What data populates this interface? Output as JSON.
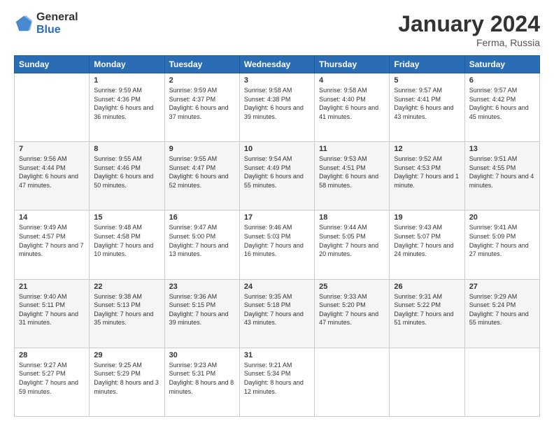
{
  "header": {
    "logo_general": "General",
    "logo_blue": "Blue",
    "month_title": "January 2024",
    "location": "Ferma, Russia"
  },
  "days_of_week": [
    "Sunday",
    "Monday",
    "Tuesday",
    "Wednesday",
    "Thursday",
    "Friday",
    "Saturday"
  ],
  "weeks": [
    [
      {
        "day": "",
        "sunrise": "",
        "sunset": "",
        "daylight": ""
      },
      {
        "day": "1",
        "sunrise": "Sunrise: 9:59 AM",
        "sunset": "Sunset: 4:36 PM",
        "daylight": "Daylight: 6 hours and 36 minutes."
      },
      {
        "day": "2",
        "sunrise": "Sunrise: 9:59 AM",
        "sunset": "Sunset: 4:37 PM",
        "daylight": "Daylight: 6 hours and 37 minutes."
      },
      {
        "day": "3",
        "sunrise": "Sunrise: 9:58 AM",
        "sunset": "Sunset: 4:38 PM",
        "daylight": "Daylight: 6 hours and 39 minutes."
      },
      {
        "day": "4",
        "sunrise": "Sunrise: 9:58 AM",
        "sunset": "Sunset: 4:40 PM",
        "daylight": "Daylight: 6 hours and 41 minutes."
      },
      {
        "day": "5",
        "sunrise": "Sunrise: 9:57 AM",
        "sunset": "Sunset: 4:41 PM",
        "daylight": "Daylight: 6 hours and 43 minutes."
      },
      {
        "day": "6",
        "sunrise": "Sunrise: 9:57 AM",
        "sunset": "Sunset: 4:42 PM",
        "daylight": "Daylight: 6 hours and 45 minutes."
      }
    ],
    [
      {
        "day": "7",
        "sunrise": "Sunrise: 9:56 AM",
        "sunset": "Sunset: 4:44 PM",
        "daylight": "Daylight: 6 hours and 47 minutes."
      },
      {
        "day": "8",
        "sunrise": "Sunrise: 9:55 AM",
        "sunset": "Sunset: 4:46 PM",
        "daylight": "Daylight: 6 hours and 50 minutes."
      },
      {
        "day": "9",
        "sunrise": "Sunrise: 9:55 AM",
        "sunset": "Sunset: 4:47 PM",
        "daylight": "Daylight: 6 hours and 52 minutes."
      },
      {
        "day": "10",
        "sunrise": "Sunrise: 9:54 AM",
        "sunset": "Sunset: 4:49 PM",
        "daylight": "Daylight: 6 hours and 55 minutes."
      },
      {
        "day": "11",
        "sunrise": "Sunrise: 9:53 AM",
        "sunset": "Sunset: 4:51 PM",
        "daylight": "Daylight: 6 hours and 58 minutes."
      },
      {
        "day": "12",
        "sunrise": "Sunrise: 9:52 AM",
        "sunset": "Sunset: 4:53 PM",
        "daylight": "Daylight: 7 hours and 1 minute."
      },
      {
        "day": "13",
        "sunrise": "Sunrise: 9:51 AM",
        "sunset": "Sunset: 4:55 PM",
        "daylight": "Daylight: 7 hours and 4 minutes."
      }
    ],
    [
      {
        "day": "14",
        "sunrise": "Sunrise: 9:49 AM",
        "sunset": "Sunset: 4:57 PM",
        "daylight": "Daylight: 7 hours and 7 minutes."
      },
      {
        "day": "15",
        "sunrise": "Sunrise: 9:48 AM",
        "sunset": "Sunset: 4:58 PM",
        "daylight": "Daylight: 7 hours and 10 minutes."
      },
      {
        "day": "16",
        "sunrise": "Sunrise: 9:47 AM",
        "sunset": "Sunset: 5:00 PM",
        "daylight": "Daylight: 7 hours and 13 minutes."
      },
      {
        "day": "17",
        "sunrise": "Sunrise: 9:46 AM",
        "sunset": "Sunset: 5:03 PM",
        "daylight": "Daylight: 7 hours and 16 minutes."
      },
      {
        "day": "18",
        "sunrise": "Sunrise: 9:44 AM",
        "sunset": "Sunset: 5:05 PM",
        "daylight": "Daylight: 7 hours and 20 minutes."
      },
      {
        "day": "19",
        "sunrise": "Sunrise: 9:43 AM",
        "sunset": "Sunset: 5:07 PM",
        "daylight": "Daylight: 7 hours and 24 minutes."
      },
      {
        "day": "20",
        "sunrise": "Sunrise: 9:41 AM",
        "sunset": "Sunset: 5:09 PM",
        "daylight": "Daylight: 7 hours and 27 minutes."
      }
    ],
    [
      {
        "day": "21",
        "sunrise": "Sunrise: 9:40 AM",
        "sunset": "Sunset: 5:11 PM",
        "daylight": "Daylight: 7 hours and 31 minutes."
      },
      {
        "day": "22",
        "sunrise": "Sunrise: 9:38 AM",
        "sunset": "Sunset: 5:13 PM",
        "daylight": "Daylight: 7 hours and 35 minutes."
      },
      {
        "day": "23",
        "sunrise": "Sunrise: 9:36 AM",
        "sunset": "Sunset: 5:15 PM",
        "daylight": "Daylight: 7 hours and 39 minutes."
      },
      {
        "day": "24",
        "sunrise": "Sunrise: 9:35 AM",
        "sunset": "Sunset: 5:18 PM",
        "daylight": "Daylight: 7 hours and 43 minutes."
      },
      {
        "day": "25",
        "sunrise": "Sunrise: 9:33 AM",
        "sunset": "Sunset: 5:20 PM",
        "daylight": "Daylight: 7 hours and 47 minutes."
      },
      {
        "day": "26",
        "sunrise": "Sunrise: 9:31 AM",
        "sunset": "Sunset: 5:22 PM",
        "daylight": "Daylight: 7 hours and 51 minutes."
      },
      {
        "day": "27",
        "sunrise": "Sunrise: 9:29 AM",
        "sunset": "Sunset: 5:24 PM",
        "daylight": "Daylight: 7 hours and 55 minutes."
      }
    ],
    [
      {
        "day": "28",
        "sunrise": "Sunrise: 9:27 AM",
        "sunset": "Sunset: 5:27 PM",
        "daylight": "Daylight: 7 hours and 59 minutes."
      },
      {
        "day": "29",
        "sunrise": "Sunrise: 9:25 AM",
        "sunset": "Sunset: 5:29 PM",
        "daylight": "Daylight: 8 hours and 3 minutes."
      },
      {
        "day": "30",
        "sunrise": "Sunrise: 9:23 AM",
        "sunset": "Sunset: 5:31 PM",
        "daylight": "Daylight: 8 hours and 8 minutes."
      },
      {
        "day": "31",
        "sunrise": "Sunrise: 9:21 AM",
        "sunset": "Sunset: 5:34 PM",
        "daylight": "Daylight: 8 hours and 12 minutes."
      },
      {
        "day": "",
        "sunrise": "",
        "sunset": "",
        "daylight": ""
      },
      {
        "day": "",
        "sunrise": "",
        "sunset": "",
        "daylight": ""
      },
      {
        "day": "",
        "sunrise": "",
        "sunset": "",
        "daylight": ""
      }
    ]
  ]
}
